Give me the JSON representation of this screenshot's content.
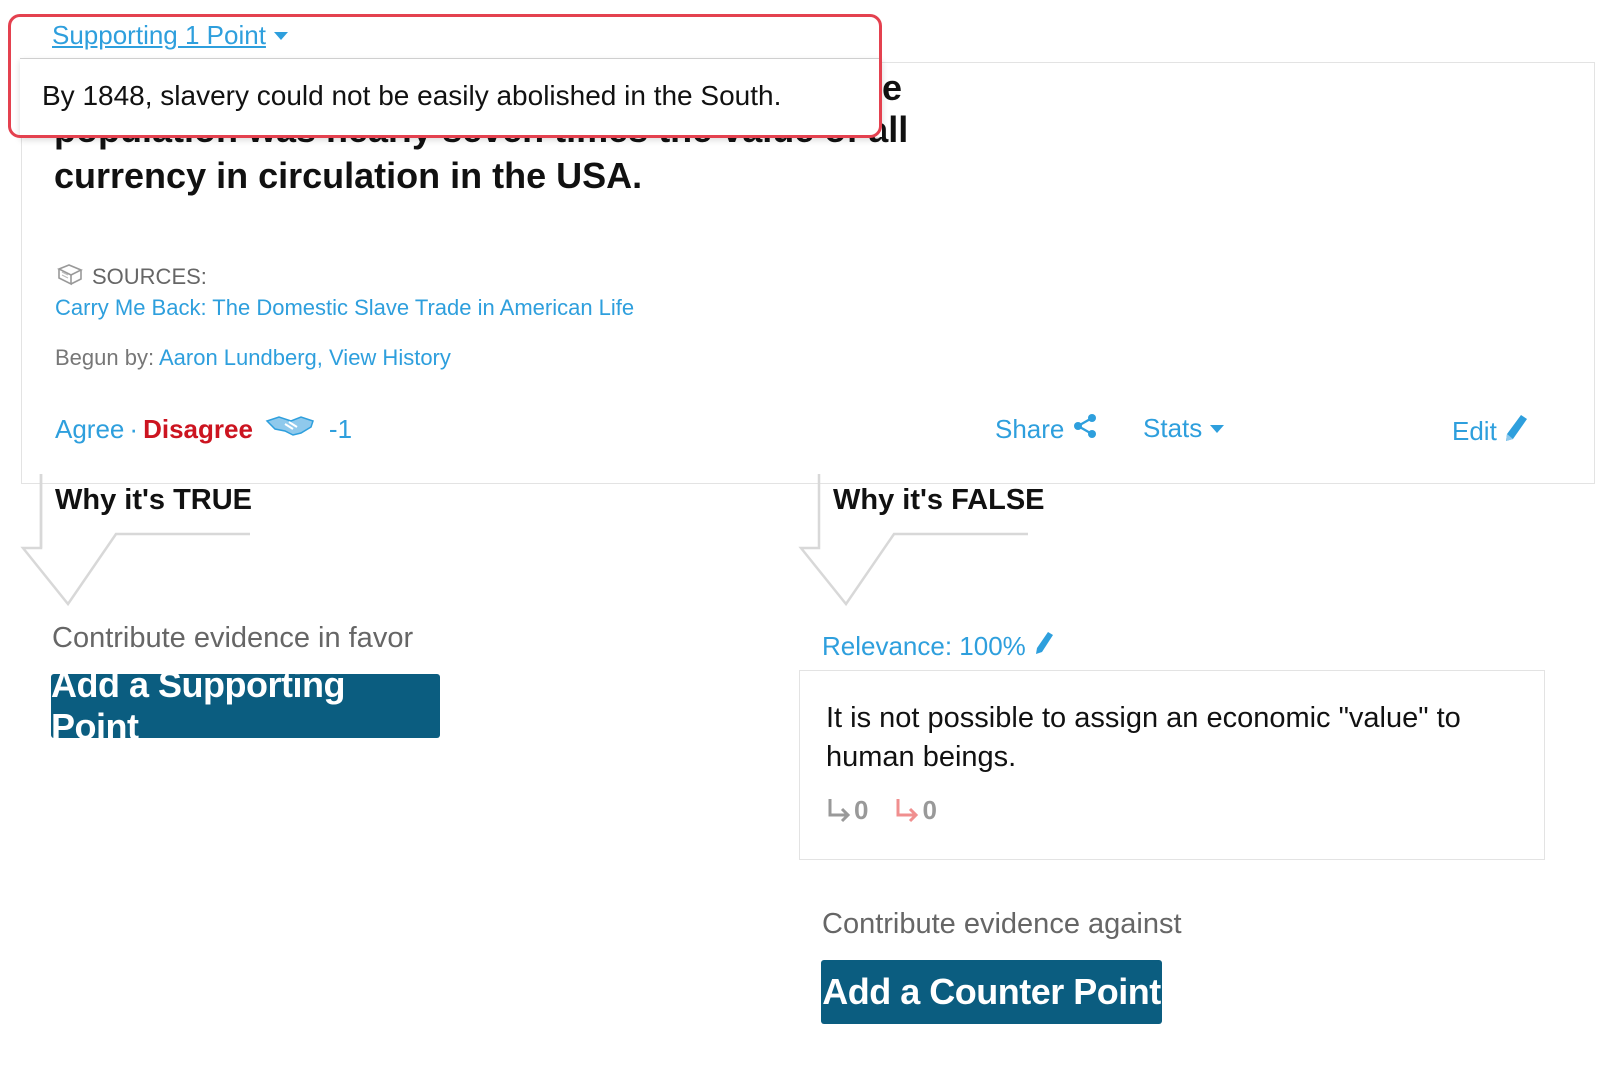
{
  "popup": {
    "link_label": "Supporting 1 Point",
    "text": "By 1848, slavery could not be easily abolished in the South."
  },
  "claim": {
    "title_visible": "population was nearly seven times the value of all currency in circulation in the USA.",
    "title_cut_fragment": "e",
    "sources_label": "SOURCES:",
    "source_link": "Carry Me Back: The Domestic Slave Trade in American Life",
    "begun_label": "Begun by:",
    "author": "Aaron Lundberg",
    "comma": ",",
    "history_link": "View History"
  },
  "actions": {
    "agree": "Agree",
    "dot": "·",
    "disagree": "Disagree",
    "score": "-1",
    "share": "Share",
    "stats": "Stats",
    "edit": "Edit"
  },
  "left_col": {
    "heading": "Why it's TRUE",
    "contribute": "Contribute evidence in favor",
    "button": "Add a Supporting Point"
  },
  "right_col": {
    "heading": "Why it's FALSE",
    "relevance": "Relevance: 100%",
    "counter_text": "It is not possible to assign an economic \"value\" to human beings.",
    "support_count": "0",
    "oppose_count": "0",
    "contribute": "Contribute evidence against",
    "button": "Add a Counter Point"
  },
  "colors": {
    "link": "#2e9fdd",
    "disagree": "#cc1420",
    "button_bg": "#0b5d80",
    "highlight_border": "#e4414f"
  }
}
